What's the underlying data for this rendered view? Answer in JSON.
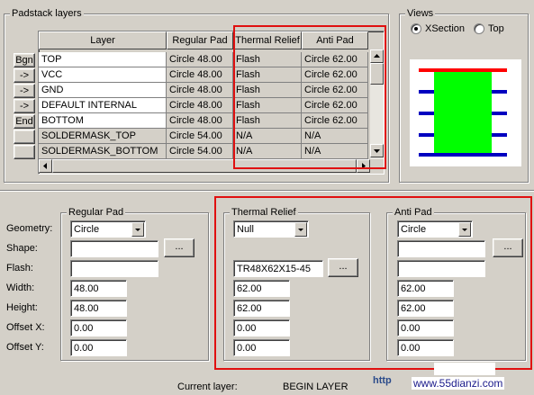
{
  "padstack_layers": {
    "title": "Padstack layers",
    "columns": [
      "Layer",
      "Regular Pad",
      "Thermal Relief",
      "Anti Pad"
    ],
    "row_buttons": [
      "Bgn",
      "->",
      "->",
      "->",
      "End",
      "",
      ""
    ],
    "rows": [
      {
        "layer": "TOP",
        "regular": "Circle 48.00",
        "thermal": "Flash",
        "anti": "Circle 62.00"
      },
      {
        "layer": "VCC",
        "regular": "Circle 48.00",
        "thermal": "Flash",
        "anti": "Circle 62.00"
      },
      {
        "layer": "GND",
        "regular": "Circle 48.00",
        "thermal": "Flash",
        "anti": "Circle 62.00"
      },
      {
        "layer": "DEFAULT INTERNAL",
        "regular": "Circle 48.00",
        "thermal": "Flash",
        "anti": "Circle 62.00"
      },
      {
        "layer": "BOTTOM",
        "regular": "Circle 48.00",
        "thermal": "Flash",
        "anti": "Circle 62.00"
      },
      {
        "layer": "SOLDERMASK_TOP",
        "regular": "Circle 54.00",
        "thermal": "N/A",
        "anti": "N/A"
      },
      {
        "layer": "SOLDERMASK_BOTTOM",
        "regular": "Circle 54.00",
        "thermal": "N/A",
        "anti": "N/A"
      }
    ]
  },
  "views": {
    "title": "Views",
    "options": [
      {
        "label": "XSection",
        "checked": true
      },
      {
        "label": "Top",
        "checked": false
      }
    ],
    "preview_colors": {
      "pad": "#ff0000",
      "layers": "#0000c0",
      "drill": "#00ff00"
    }
  },
  "field_labels": {
    "geometry": "Geometry:",
    "shape": "Shape:",
    "flash": "Flash:",
    "width": "Width:",
    "height": "Height:",
    "offset_x": "Offset X:",
    "offset_y": "Offset Y:"
  },
  "regular_pad": {
    "title": "Regular Pad",
    "geometry": "Circle",
    "shape": "",
    "flash": "",
    "width": "48.00",
    "height": "48.00",
    "offset_x": "0.00",
    "offset_y": "0.00",
    "browse_label": "..."
  },
  "thermal_relief": {
    "title": "Thermal Relief",
    "geometry": "Null",
    "flash": "TR48X62X15-45",
    "width": "62.00",
    "height": "62.00",
    "offset_x": "0.00",
    "offset_y": "0.00",
    "browse_label": "..."
  },
  "anti_pad": {
    "title": "Anti Pad",
    "geometry": "Circle",
    "shape": "",
    "flash": "",
    "width": "62.00",
    "height": "62.00",
    "offset_x": "0.00",
    "offset_y": "0.00",
    "browse_label": "..."
  },
  "status": {
    "current_layer_label": "Current layer:",
    "current_layer_value": "BEGIN LAYER",
    "watermark": "www.55dianzi.com",
    "watermark_prefix": "http"
  },
  "highlight_color": "#e01010"
}
